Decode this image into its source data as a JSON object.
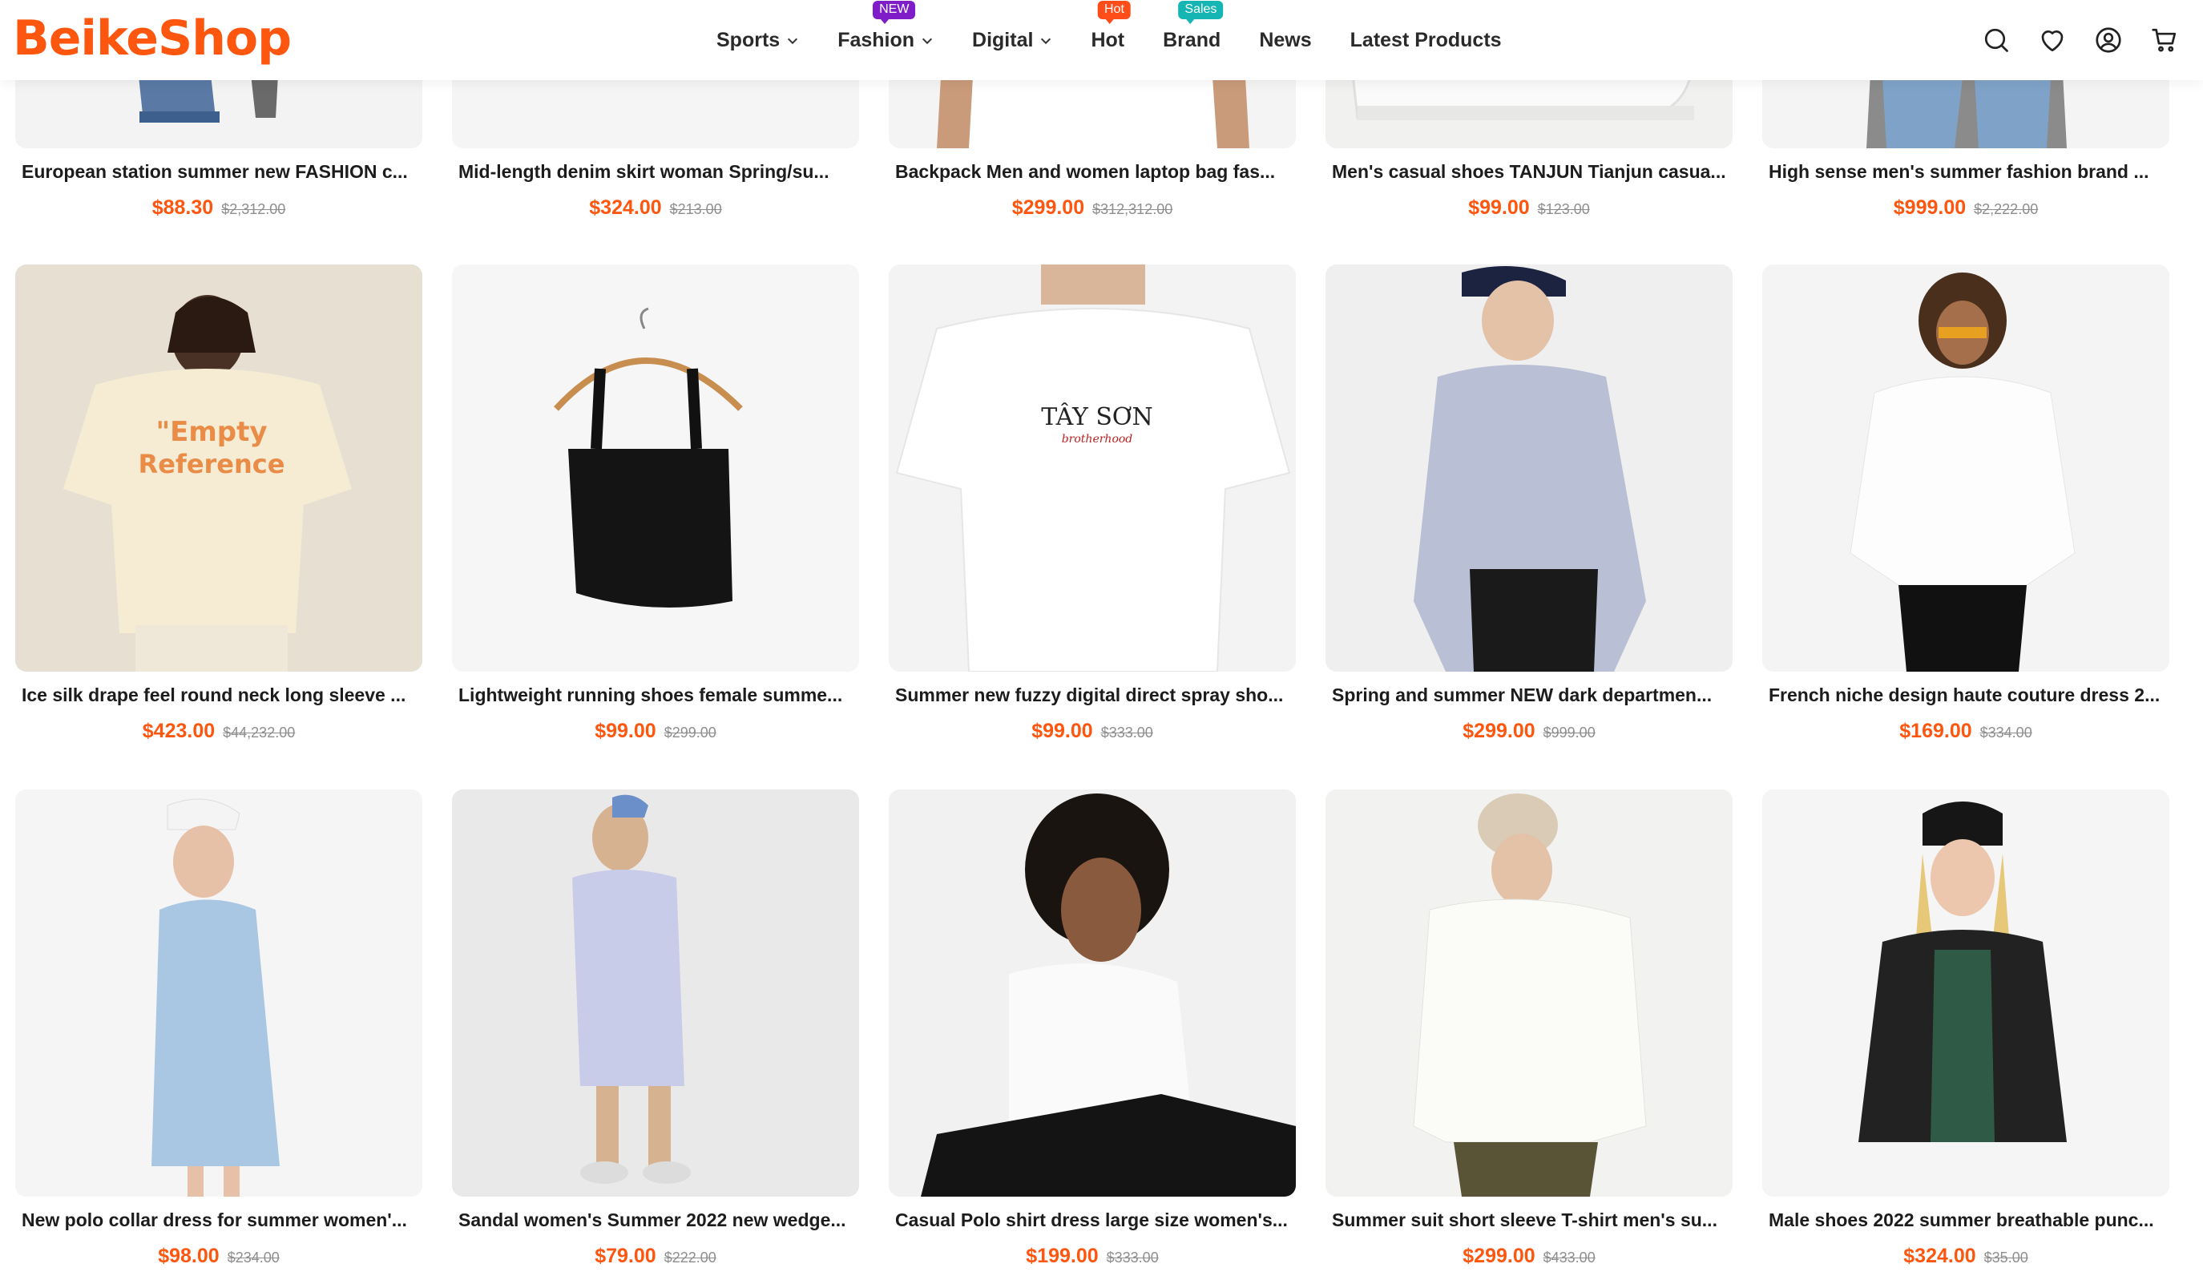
{
  "brand": {
    "name": "BeikeShop",
    "color": "#fd560f"
  },
  "nav": {
    "items": [
      {
        "label": "Sports",
        "has_dropdown": true,
        "badge": ""
      },
      {
        "label": "Fashion",
        "has_dropdown": true,
        "badge": "NEW"
      },
      {
        "label": "Digital",
        "has_dropdown": true,
        "badge": ""
      },
      {
        "label": "Hot",
        "has_dropdown": false,
        "badge": "Hot"
      },
      {
        "label": "Brand",
        "has_dropdown": false,
        "badge": "Sales"
      },
      {
        "label": "News",
        "has_dropdown": false,
        "badge": ""
      },
      {
        "label": "Latest Products",
        "has_dropdown": false,
        "badge": ""
      }
    ]
  },
  "header_icons": [
    "search-icon",
    "wishlist-heart-icon",
    "account-icon",
    "cart-icon"
  ],
  "colors": {
    "accent": "#fd560f",
    "badge_new": "#7f1dc9",
    "badge_hot": "#ff4d1a",
    "badge_sales": "#14b5b2"
  },
  "products": [
    {
      "name": "European station summer new FASHION c...",
      "price": "$88.30",
      "old_price": "$2,312.00"
    },
    {
      "name": "Mid-length denim skirt woman Spring/su...",
      "price": "$324.00",
      "old_price": "$213.00"
    },
    {
      "name": "Backpack Men and women laptop bag fas...",
      "price": "$299.00",
      "old_price": "$312,312.00"
    },
    {
      "name": "Men's casual shoes TANJUN Tianjun casua...",
      "price": "$99.00",
      "old_price": "$123.00"
    },
    {
      "name": "High sense men's summer fashion brand ...",
      "price": "$999.00",
      "old_price": "$2,222.00"
    },
    {
      "name": "Ice silk drape feel round neck long sleeve ...",
      "price": "$423.00",
      "old_price": "$44,232.00"
    },
    {
      "name": "Lightweight running shoes female summe...",
      "price": "$99.00",
      "old_price": "$299.00"
    },
    {
      "name": "Summer new fuzzy digital direct spray sho...",
      "price": "$99.00",
      "old_price": "$333.00"
    },
    {
      "name": "Spring and summer NEW dark departmen...",
      "price": "$299.00",
      "old_price": "$999.00"
    },
    {
      "name": "French niche design haute couture dress 2...",
      "price": "$169.00",
      "old_price": "$334.00"
    },
    {
      "name": "New polo collar dress for summer women'...",
      "price": "$98.00",
      "old_price": "$234.00"
    },
    {
      "name": "Sandal women's Summer 2022 new wedge...",
      "price": "$79.00",
      "old_price": "$222.00"
    },
    {
      "name": "Casual Polo shirt dress large size women's...",
      "price": "$199.00",
      "old_price": "$333.00"
    },
    {
      "name": "Summer suit short sleeve T-shirt men's su...",
      "price": "$299.00",
      "old_price": "$433.00"
    },
    {
      "name": "Male shoes 2022 summer breathable punc...",
      "price": "$324.00",
      "old_price": "$35.00"
    }
  ],
  "product_art": {
    "empty_reference_print": [
      "\"Empty",
      "Reference"
    ],
    "tayson_print": [
      "TÂY SƠN",
      "brotherhood"
    ]
  }
}
